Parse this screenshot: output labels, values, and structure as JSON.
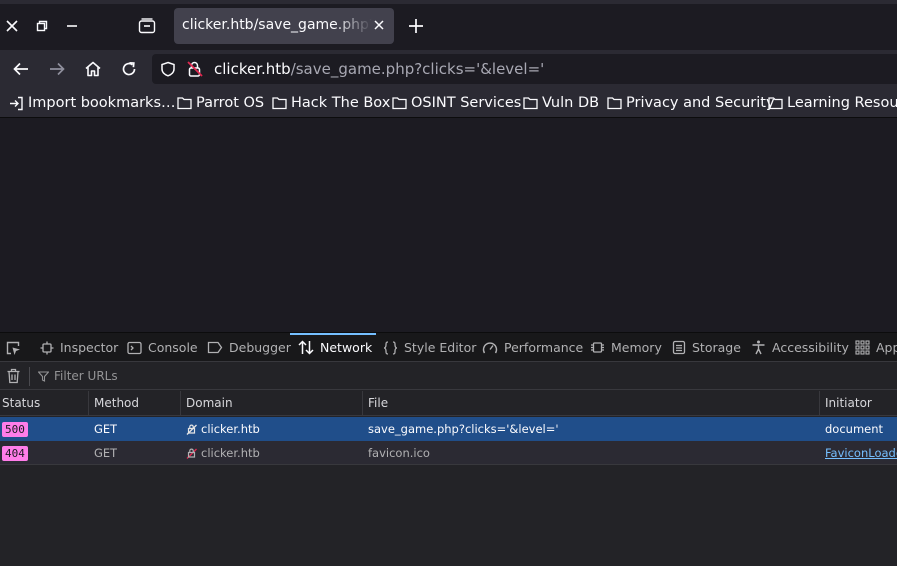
{
  "browser": {
    "tab": {
      "title": "clicker.htb/save_game.php?clicks='&level='"
    },
    "url": {
      "host": "clicker.htb",
      "path": "/save_game.php?clicks='&level='"
    },
    "bookmarks": [
      {
        "label": "Import bookmarks…",
        "icon": "import-icon"
      },
      {
        "label": "Parrot OS",
        "icon": "folder-icon"
      },
      {
        "label": "Hack The Box",
        "icon": "folder-icon"
      },
      {
        "label": "OSINT Services",
        "icon": "folder-icon"
      },
      {
        "label": "Vuln DB",
        "icon": "folder-icon"
      },
      {
        "label": "Privacy and Security",
        "icon": "folder-icon"
      },
      {
        "label": "Learning Resources",
        "icon": "folder-icon"
      }
    ]
  },
  "devtools": {
    "tabs": [
      {
        "label": "Inspector",
        "icon": "inspector-icon"
      },
      {
        "label": "Console",
        "icon": "console-icon"
      },
      {
        "label": "Debugger",
        "icon": "debugger-icon"
      },
      {
        "label": "Network",
        "icon": "network-icon",
        "active": true
      },
      {
        "label": "Style Editor",
        "icon": "braces-icon"
      },
      {
        "label": "Performance",
        "icon": "gauge-icon"
      },
      {
        "label": "Memory",
        "icon": "chip-icon"
      },
      {
        "label": "Storage",
        "icon": "storage-icon"
      },
      {
        "label": "Accessibility",
        "icon": "accessibility-icon"
      },
      {
        "label": "App",
        "icon": "grid-icon"
      }
    ],
    "filter_placeholder": "Filter URLs",
    "columns": [
      "Status",
      "Method",
      "Domain",
      "File",
      "Initiator"
    ],
    "rows": [
      {
        "status": "500",
        "method": "GET",
        "domain": "clicker.htb",
        "file": "save_game.php?clicks='&level='",
        "initiator": "document",
        "selected": true
      },
      {
        "status": "404",
        "method": "GET",
        "domain": "clicker.htb",
        "file": "favicon.ico",
        "initiator": "FaviconLoader",
        "selected": false
      }
    ],
    "colors": {
      "accent": "#75bfff",
      "selected_row": "#204e8a",
      "status_badge": "#ff7de9"
    }
  }
}
